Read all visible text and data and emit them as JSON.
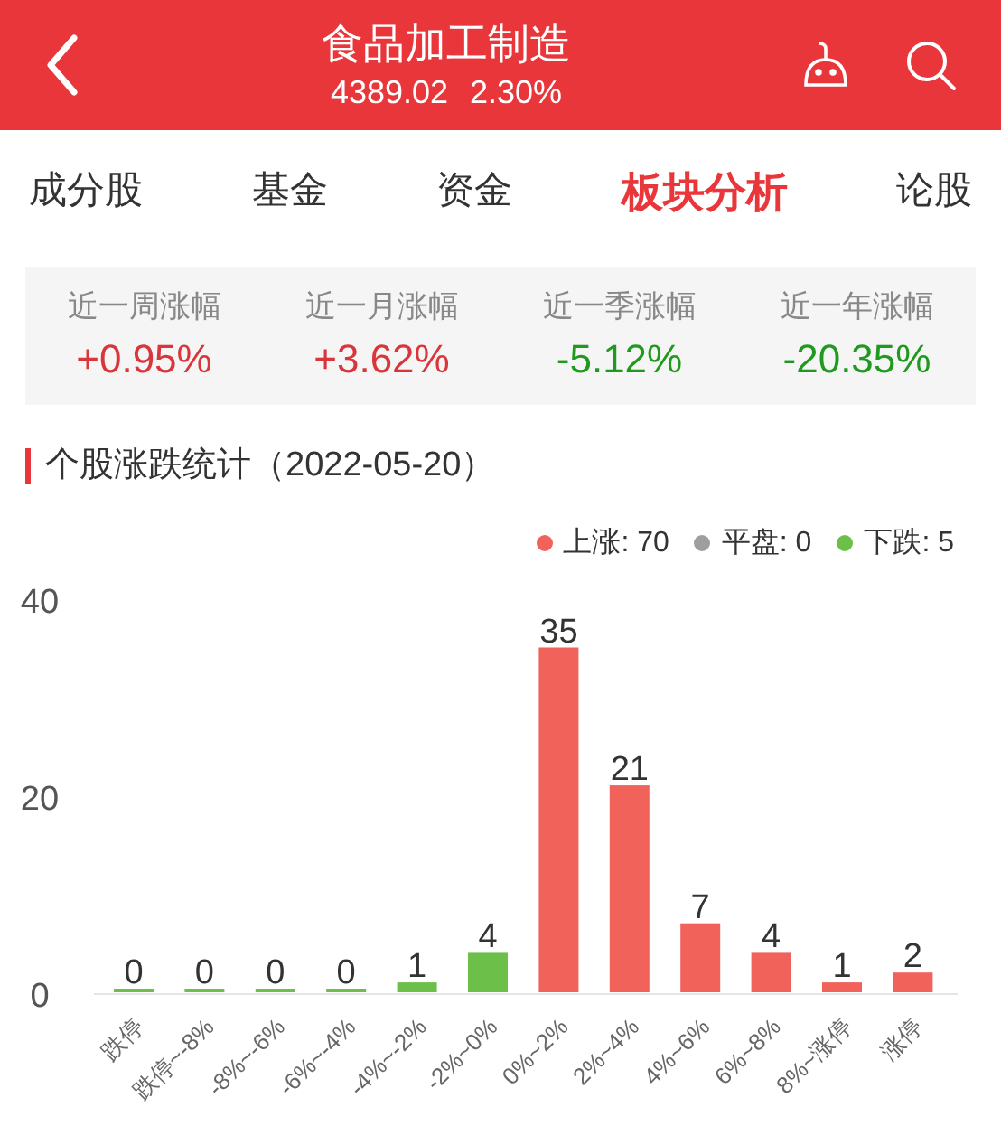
{
  "header": {
    "title": "食品加工制造",
    "price": "4389.02",
    "change": "2.30%"
  },
  "tabs": [
    {
      "label": "成分股",
      "selected": false
    },
    {
      "label": "基金",
      "selected": false
    },
    {
      "label": "资金",
      "selected": false
    },
    {
      "label": "板块分析",
      "selected": true
    },
    {
      "label": "论股",
      "selected": false
    }
  ],
  "stats": [
    {
      "label": "近一周涨幅",
      "value": "+0.95%",
      "color": "#d9363c"
    },
    {
      "label": "近一月涨幅",
      "value": "+3.62%",
      "color": "#d9363c"
    },
    {
      "label": "近一季涨幅",
      "value": "-5.12%",
      "color": "#1f9a1f"
    },
    {
      "label": "近一年涨幅",
      "value": "-20.35%",
      "color": "#1f9a1f"
    }
  ],
  "section_title": "个股涨跌统计（2022-05-20）",
  "legend": [
    {
      "label": "上涨: 70",
      "color": "#f0625a"
    },
    {
      "label": "平盘: 0",
      "color": "#9e9e9e"
    },
    {
      "label": "下跌: 5",
      "color": "#6cc04a"
    }
  ],
  "chart_data": {
    "type": "bar",
    "categories": [
      "跌停",
      "跌停~-8%",
      "-8%~-6%",
      "-6%~-4%",
      "-4%~-2%",
      "-2%~0%",
      "0%~2%",
      "2%~4%",
      "4%~6%",
      "6%~8%",
      "8%~涨停",
      "涨停"
    ],
    "series": [
      {
        "color": "#f0625a",
        "values": [
          null,
          null,
          null,
          null,
          null,
          null,
          35,
          21,
          7,
          4,
          1,
          2
        ]
      },
      {
        "color": "#6cc04a",
        "values": [
          0,
          0,
          0,
          0,
          1,
          4,
          null,
          null,
          null,
          null,
          null,
          null
        ]
      }
    ],
    "ylim": [
      0,
      40
    ],
    "yticks": [
      0,
      20,
      40
    ],
    "data_labels": true
  }
}
